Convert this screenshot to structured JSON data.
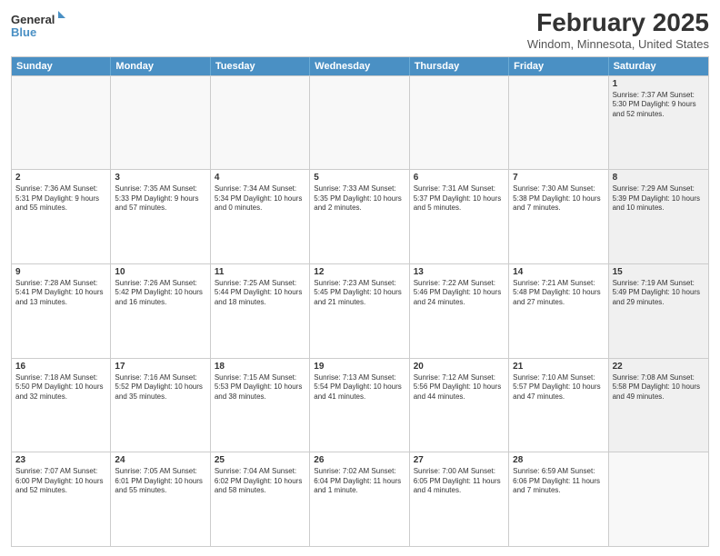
{
  "logo": {
    "line1": "General",
    "line2": "Blue"
  },
  "title": "February 2025",
  "location": "Windom, Minnesota, United States",
  "weekdays": [
    "Sunday",
    "Monday",
    "Tuesday",
    "Wednesday",
    "Thursday",
    "Friday",
    "Saturday"
  ],
  "weeks": [
    [
      {
        "day": "",
        "text": "",
        "empty": true
      },
      {
        "day": "",
        "text": "",
        "empty": true
      },
      {
        "day": "",
        "text": "",
        "empty": true
      },
      {
        "day": "",
        "text": "",
        "empty": true
      },
      {
        "day": "",
        "text": "",
        "empty": true
      },
      {
        "day": "",
        "text": "",
        "empty": true
      },
      {
        "day": "1",
        "text": "Sunrise: 7:37 AM\nSunset: 5:30 PM\nDaylight: 9 hours and 52 minutes.",
        "shaded": true
      }
    ],
    [
      {
        "day": "2",
        "text": "Sunrise: 7:36 AM\nSunset: 5:31 PM\nDaylight: 9 hours and 55 minutes.",
        "shaded": false
      },
      {
        "day": "3",
        "text": "Sunrise: 7:35 AM\nSunset: 5:33 PM\nDaylight: 9 hours and 57 minutes.",
        "shaded": false
      },
      {
        "day": "4",
        "text": "Sunrise: 7:34 AM\nSunset: 5:34 PM\nDaylight: 10 hours and 0 minutes.",
        "shaded": false
      },
      {
        "day": "5",
        "text": "Sunrise: 7:33 AM\nSunset: 5:35 PM\nDaylight: 10 hours and 2 minutes.",
        "shaded": false
      },
      {
        "day": "6",
        "text": "Sunrise: 7:31 AM\nSunset: 5:37 PM\nDaylight: 10 hours and 5 minutes.",
        "shaded": false
      },
      {
        "day": "7",
        "text": "Sunrise: 7:30 AM\nSunset: 5:38 PM\nDaylight: 10 hours and 7 minutes.",
        "shaded": false
      },
      {
        "day": "8",
        "text": "Sunrise: 7:29 AM\nSunset: 5:39 PM\nDaylight: 10 hours and 10 minutes.",
        "shaded": true
      }
    ],
    [
      {
        "day": "9",
        "text": "Sunrise: 7:28 AM\nSunset: 5:41 PM\nDaylight: 10 hours and 13 minutes.",
        "shaded": false
      },
      {
        "day": "10",
        "text": "Sunrise: 7:26 AM\nSunset: 5:42 PM\nDaylight: 10 hours and 16 minutes.",
        "shaded": false
      },
      {
        "day": "11",
        "text": "Sunrise: 7:25 AM\nSunset: 5:44 PM\nDaylight: 10 hours and 18 minutes.",
        "shaded": false
      },
      {
        "day": "12",
        "text": "Sunrise: 7:23 AM\nSunset: 5:45 PM\nDaylight: 10 hours and 21 minutes.",
        "shaded": false
      },
      {
        "day": "13",
        "text": "Sunrise: 7:22 AM\nSunset: 5:46 PM\nDaylight: 10 hours and 24 minutes.",
        "shaded": false
      },
      {
        "day": "14",
        "text": "Sunrise: 7:21 AM\nSunset: 5:48 PM\nDaylight: 10 hours and 27 minutes.",
        "shaded": false
      },
      {
        "day": "15",
        "text": "Sunrise: 7:19 AM\nSunset: 5:49 PM\nDaylight: 10 hours and 29 minutes.",
        "shaded": true
      }
    ],
    [
      {
        "day": "16",
        "text": "Sunrise: 7:18 AM\nSunset: 5:50 PM\nDaylight: 10 hours and 32 minutes.",
        "shaded": false
      },
      {
        "day": "17",
        "text": "Sunrise: 7:16 AM\nSunset: 5:52 PM\nDaylight: 10 hours and 35 minutes.",
        "shaded": false
      },
      {
        "day": "18",
        "text": "Sunrise: 7:15 AM\nSunset: 5:53 PM\nDaylight: 10 hours and 38 minutes.",
        "shaded": false
      },
      {
        "day": "19",
        "text": "Sunrise: 7:13 AM\nSunset: 5:54 PM\nDaylight: 10 hours and 41 minutes.",
        "shaded": false
      },
      {
        "day": "20",
        "text": "Sunrise: 7:12 AM\nSunset: 5:56 PM\nDaylight: 10 hours and 44 minutes.",
        "shaded": false
      },
      {
        "day": "21",
        "text": "Sunrise: 7:10 AM\nSunset: 5:57 PM\nDaylight: 10 hours and 47 minutes.",
        "shaded": false
      },
      {
        "day": "22",
        "text": "Sunrise: 7:08 AM\nSunset: 5:58 PM\nDaylight: 10 hours and 49 minutes.",
        "shaded": true
      }
    ],
    [
      {
        "day": "23",
        "text": "Sunrise: 7:07 AM\nSunset: 6:00 PM\nDaylight: 10 hours and 52 minutes.",
        "shaded": false
      },
      {
        "day": "24",
        "text": "Sunrise: 7:05 AM\nSunset: 6:01 PM\nDaylight: 10 hours and 55 minutes.",
        "shaded": false
      },
      {
        "day": "25",
        "text": "Sunrise: 7:04 AM\nSunset: 6:02 PM\nDaylight: 10 hours and 58 minutes.",
        "shaded": false
      },
      {
        "day": "26",
        "text": "Sunrise: 7:02 AM\nSunset: 6:04 PM\nDaylight: 11 hours and 1 minute.",
        "shaded": false
      },
      {
        "day": "27",
        "text": "Sunrise: 7:00 AM\nSunset: 6:05 PM\nDaylight: 11 hours and 4 minutes.",
        "shaded": false
      },
      {
        "day": "28",
        "text": "Sunrise: 6:59 AM\nSunset: 6:06 PM\nDaylight: 11 hours and 7 minutes.",
        "shaded": false
      },
      {
        "day": "",
        "text": "",
        "empty": true,
        "shaded": true
      }
    ]
  ]
}
